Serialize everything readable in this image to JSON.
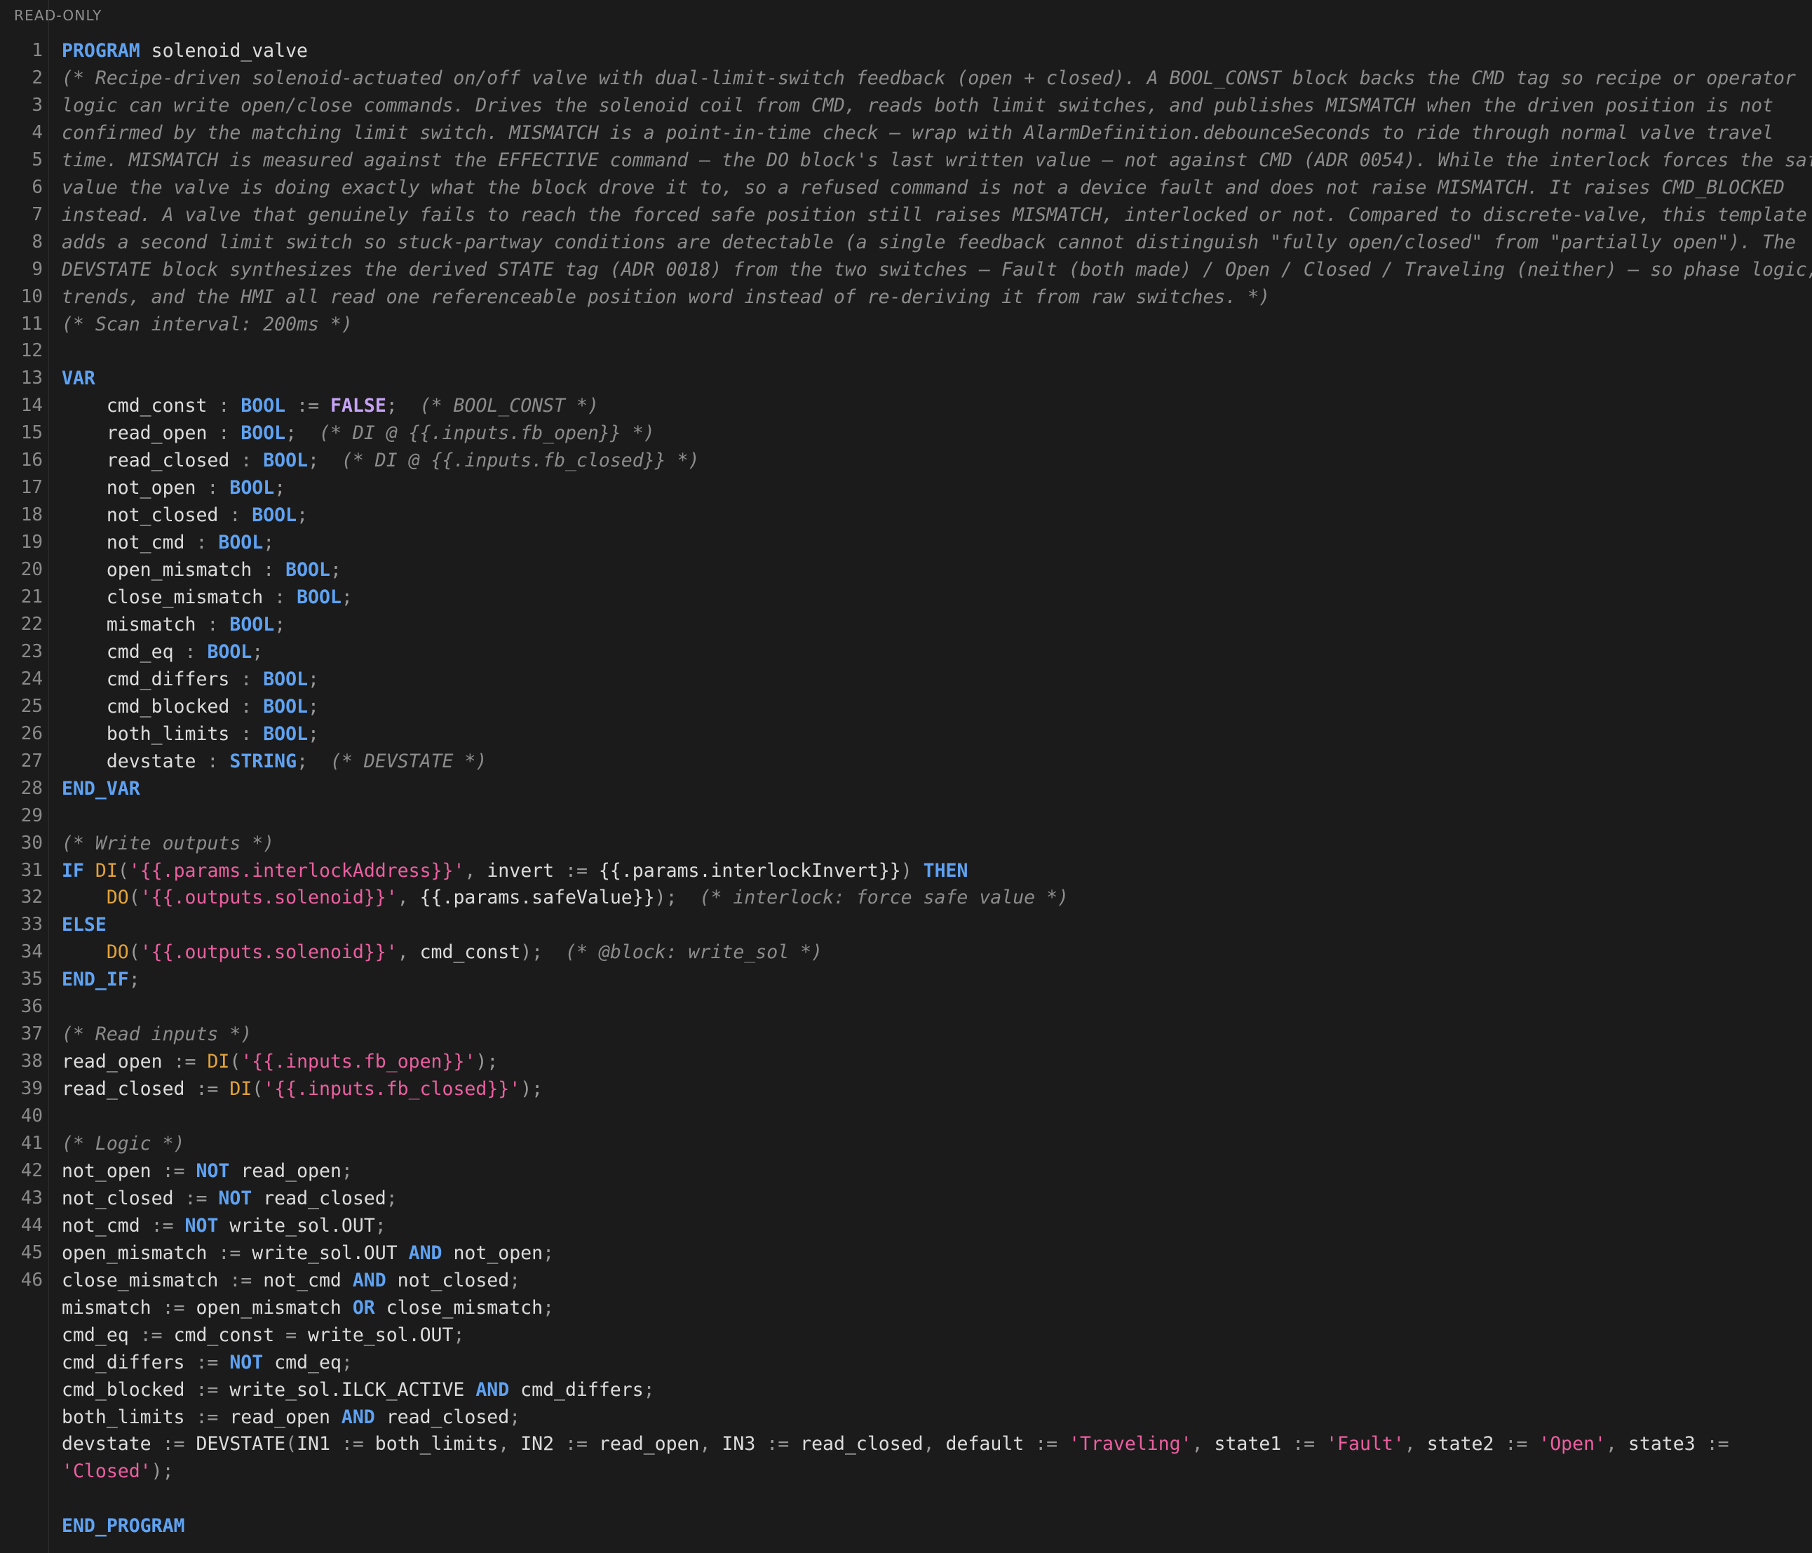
{
  "status": "READ-ONLY",
  "line_numbers": [
    "1",
    "2",
    "3",
    "4",
    "5",
    "6",
    "7",
    "8",
    "9",
    "10",
    "11",
    "12",
    "13",
    "14",
    "15",
    "16",
    "17",
    "18",
    "19",
    "20",
    "21",
    "22",
    "23",
    "24",
    "25",
    "26",
    "27",
    "28",
    "29",
    "30",
    "31",
    "32",
    "33",
    "34",
    "35",
    "36",
    "37",
    "38",
    "39",
    "40",
    "41",
    "42",
    "43",
    "44",
    "45",
    "46"
  ],
  "lines": [
    [
      [
        "kw",
        "PROGRAM"
      ],
      [
        "pl",
        " solenoid_valve"
      ]
    ],
    [
      [
        "cm",
        "(* Recipe-driven solenoid-actuated on/off valve with dual-limit-switch feedback (open + closed). A BOOL_CONST block backs the CMD tag so recipe or operator"
      ]
    ],
    [
      [
        "cm",
        "logic can write open/close commands. Drives the solenoid coil from CMD, reads both limit switches, and publishes MISMATCH when the driven position is not"
      ]
    ],
    [
      [
        "cm",
        "confirmed by the matching limit switch. MISMATCH is a point-in-time check — wrap with AlarmDefinition.debounceSeconds to ride through normal valve travel"
      ]
    ],
    [
      [
        "cm",
        "time. MISMATCH is measured against the EFFECTIVE command — the DO block's last written value — not against CMD (ADR 0054). While the interlock forces the safe"
      ]
    ],
    [
      [
        "cm",
        "value the valve is doing exactly what the block drove it to, so a refused command is not a device fault and does not raise MISMATCH. It raises CMD_BLOCKED"
      ]
    ],
    [
      [
        "cm",
        "instead. A valve that genuinely fails to reach the forced safe position still raises MISMATCH, interlocked or not. Compared to discrete-valve, this template"
      ]
    ],
    [
      [
        "cm",
        "adds a second limit switch so stuck-partway conditions are detectable (a single feedback cannot distinguish \"fully open/closed\" from \"partially open\"). The"
      ]
    ],
    [
      [
        "cm",
        "DEVSTATE block synthesizes the derived STATE tag (ADR 0018) from the two switches — Fault (both made) / Open / Closed / Traveling (neither) — so phase logic,"
      ]
    ],
    [
      [
        "cm",
        "trends, and the HMI all read one referenceable position word instead of re-deriving it from raw switches. *)"
      ]
    ],
    [
      [
        "cm",
        "(* Scan interval: 200ms *)"
      ]
    ],
    [],
    [
      [
        "kw",
        "VAR"
      ]
    ],
    [
      [
        "pl",
        "    cmd_const "
      ],
      [
        "op",
        ":"
      ],
      [
        "pl",
        " "
      ],
      [
        "ty",
        "BOOL"
      ],
      [
        "pl",
        " "
      ],
      [
        "op",
        ":="
      ],
      [
        "pl",
        " "
      ],
      [
        "lit",
        "FALSE"
      ],
      [
        "op",
        ";"
      ],
      [
        "pl",
        "  "
      ],
      [
        "cm",
        "(* BOOL_CONST *)"
      ]
    ],
    [
      [
        "pl",
        "    read_open "
      ],
      [
        "op",
        ":"
      ],
      [
        "pl",
        " "
      ],
      [
        "ty",
        "BOOL"
      ],
      [
        "op",
        ";"
      ],
      [
        "pl",
        "  "
      ],
      [
        "cm",
        "(* DI @ {{.inputs.fb_open}} *)"
      ]
    ],
    [
      [
        "pl",
        "    read_closed "
      ],
      [
        "op",
        ":"
      ],
      [
        "pl",
        " "
      ],
      [
        "ty",
        "BOOL"
      ],
      [
        "op",
        ";"
      ],
      [
        "pl",
        "  "
      ],
      [
        "cm",
        "(* DI @ {{.inputs.fb_closed}} *)"
      ]
    ],
    [
      [
        "pl",
        "    not_open "
      ],
      [
        "op",
        ":"
      ],
      [
        "pl",
        " "
      ],
      [
        "ty",
        "BOOL"
      ],
      [
        "op",
        ";"
      ]
    ],
    [
      [
        "pl",
        "    not_closed "
      ],
      [
        "op",
        ":"
      ],
      [
        "pl",
        " "
      ],
      [
        "ty",
        "BOOL"
      ],
      [
        "op",
        ";"
      ]
    ],
    [
      [
        "pl",
        "    not_cmd "
      ],
      [
        "op",
        ":"
      ],
      [
        "pl",
        " "
      ],
      [
        "ty",
        "BOOL"
      ],
      [
        "op",
        ";"
      ]
    ],
    [
      [
        "pl",
        "    open_mismatch "
      ],
      [
        "op",
        ":"
      ],
      [
        "pl",
        " "
      ],
      [
        "ty",
        "BOOL"
      ],
      [
        "op",
        ";"
      ]
    ],
    [
      [
        "pl",
        "    close_mismatch "
      ],
      [
        "op",
        ":"
      ],
      [
        "pl",
        " "
      ],
      [
        "ty",
        "BOOL"
      ],
      [
        "op",
        ";"
      ]
    ],
    [
      [
        "pl",
        "    mismatch "
      ],
      [
        "op",
        ":"
      ],
      [
        "pl",
        " "
      ],
      [
        "ty",
        "BOOL"
      ],
      [
        "op",
        ";"
      ]
    ],
    [
      [
        "pl",
        "    cmd_eq "
      ],
      [
        "op",
        ":"
      ],
      [
        "pl",
        " "
      ],
      [
        "ty",
        "BOOL"
      ],
      [
        "op",
        ";"
      ]
    ],
    [
      [
        "pl",
        "    cmd_differs "
      ],
      [
        "op",
        ":"
      ],
      [
        "pl",
        " "
      ],
      [
        "ty",
        "BOOL"
      ],
      [
        "op",
        ";"
      ]
    ],
    [
      [
        "pl",
        "    cmd_blocked "
      ],
      [
        "op",
        ":"
      ],
      [
        "pl",
        " "
      ],
      [
        "ty",
        "BOOL"
      ],
      [
        "op",
        ";"
      ]
    ],
    [
      [
        "pl",
        "    both_limits "
      ],
      [
        "op",
        ":"
      ],
      [
        "pl",
        " "
      ],
      [
        "ty",
        "BOOL"
      ],
      [
        "op",
        ";"
      ]
    ],
    [
      [
        "pl",
        "    devstate "
      ],
      [
        "op",
        ":"
      ],
      [
        "pl",
        " "
      ],
      [
        "ty",
        "STRING"
      ],
      [
        "op",
        ";"
      ],
      [
        "pl",
        "  "
      ],
      [
        "cm",
        "(* DEVSTATE *)"
      ]
    ],
    [
      [
        "kw",
        "END_VAR"
      ]
    ],
    [],
    [
      [
        "cm",
        "(* Write outputs *)"
      ]
    ],
    [
      [
        "kw",
        "IF"
      ],
      [
        "pl",
        " "
      ],
      [
        "fn",
        "DI"
      ],
      [
        "op",
        "("
      ],
      [
        "str",
        "'{{.params.interlockAddress}}'"
      ],
      [
        "op",
        ","
      ],
      [
        "pl",
        " invert "
      ],
      [
        "op",
        ":="
      ],
      [
        "pl",
        " {{.params.interlockInvert}}"
      ],
      [
        "op",
        ")"
      ],
      [
        "pl",
        " "
      ],
      [
        "kw",
        "THEN"
      ]
    ],
    [
      [
        "pl",
        "    "
      ],
      [
        "fn",
        "DO"
      ],
      [
        "op",
        "("
      ],
      [
        "str",
        "'{{.outputs.solenoid}}'"
      ],
      [
        "op",
        ","
      ],
      [
        "pl",
        " {{.params.safeValue}}"
      ],
      [
        "op",
        ");"
      ],
      [
        "pl",
        "  "
      ],
      [
        "cm",
        "(* interlock: force safe value *)"
      ]
    ],
    [
      [
        "kw",
        "ELSE"
      ]
    ],
    [
      [
        "pl",
        "    "
      ],
      [
        "fn",
        "DO"
      ],
      [
        "op",
        "("
      ],
      [
        "str",
        "'{{.outputs.solenoid}}'"
      ],
      [
        "op",
        ","
      ],
      [
        "pl",
        " cmd_const"
      ],
      [
        "op",
        ");"
      ],
      [
        "pl",
        "  "
      ],
      [
        "cm",
        "(* @block: write_sol *)"
      ]
    ],
    [
      [
        "kw",
        "END_IF"
      ],
      [
        "op",
        ";"
      ]
    ],
    [],
    [
      [
        "cm",
        "(* Read inputs *)"
      ]
    ],
    [
      [
        "pl",
        "read_open "
      ],
      [
        "op",
        ":="
      ],
      [
        "pl",
        " "
      ],
      [
        "fn",
        "DI"
      ],
      [
        "op",
        "("
      ],
      [
        "str",
        "'{{.inputs.fb_open}}'"
      ],
      [
        "op",
        ");"
      ]
    ],
    [
      [
        "pl",
        "read_closed "
      ],
      [
        "op",
        ":="
      ],
      [
        "pl",
        " "
      ],
      [
        "fn",
        "DI"
      ],
      [
        "op",
        "("
      ],
      [
        "str",
        "'{{.inputs.fb_closed}}'"
      ],
      [
        "op",
        ");"
      ]
    ],
    [],
    [
      [
        "cm",
        "(* Logic *)"
      ]
    ],
    [
      [
        "pl",
        "not_open "
      ],
      [
        "op",
        ":="
      ],
      [
        "pl",
        " "
      ],
      [
        "kw",
        "NOT"
      ],
      [
        "pl",
        " read_open"
      ],
      [
        "op",
        ";"
      ]
    ],
    [
      [
        "pl",
        "not_closed "
      ],
      [
        "op",
        ":="
      ],
      [
        "pl",
        " "
      ],
      [
        "kw",
        "NOT"
      ],
      [
        "pl",
        " read_closed"
      ],
      [
        "op",
        ";"
      ]
    ],
    [
      [
        "pl",
        "not_cmd "
      ],
      [
        "op",
        ":="
      ],
      [
        "pl",
        " "
      ],
      [
        "kw",
        "NOT"
      ],
      [
        "pl",
        " write_sol.OUT"
      ],
      [
        "op",
        ";"
      ]
    ],
    [
      [
        "pl",
        "open_mismatch "
      ],
      [
        "op",
        ":="
      ],
      [
        "pl",
        " write_sol.OUT "
      ],
      [
        "kw",
        "AND"
      ],
      [
        "pl",
        " not_open"
      ],
      [
        "op",
        ";"
      ]
    ],
    [
      [
        "pl",
        "close_mismatch "
      ],
      [
        "op",
        ":="
      ],
      [
        "pl",
        " not_cmd "
      ],
      [
        "kw",
        "AND"
      ],
      [
        "pl",
        " not_closed"
      ],
      [
        "op",
        ";"
      ]
    ],
    [
      [
        "pl",
        "mismatch "
      ],
      [
        "op",
        ":="
      ],
      [
        "pl",
        " open_mismatch "
      ],
      [
        "kw",
        "OR"
      ],
      [
        "pl",
        " close_mismatch"
      ],
      [
        "op",
        ";"
      ]
    ],
    [
      [
        "pl",
        "cmd_eq "
      ],
      [
        "op",
        ":="
      ],
      [
        "pl",
        " cmd_const "
      ],
      [
        "op",
        "="
      ],
      [
        "pl",
        " write_sol.OUT"
      ],
      [
        "op",
        ";"
      ]
    ],
    [
      [
        "pl",
        "cmd_differs "
      ],
      [
        "op",
        ":="
      ],
      [
        "pl",
        " "
      ],
      [
        "kw",
        "NOT"
      ],
      [
        "pl",
        " cmd_eq"
      ],
      [
        "op",
        ";"
      ]
    ],
    [
      [
        "pl",
        "cmd_blocked "
      ],
      [
        "op",
        ":="
      ],
      [
        "pl",
        " write_sol.ILCK_ACTIVE "
      ],
      [
        "kw",
        "AND"
      ],
      [
        "pl",
        " cmd_differs"
      ],
      [
        "op",
        ";"
      ]
    ],
    [
      [
        "pl",
        "both_limits "
      ],
      [
        "op",
        ":="
      ],
      [
        "pl",
        " read_open "
      ],
      [
        "kw",
        "AND"
      ],
      [
        "pl",
        " read_closed"
      ],
      [
        "op",
        ";"
      ]
    ],
    [
      [
        "pl",
        "devstate "
      ],
      [
        "op",
        ":="
      ],
      [
        "pl",
        " DEVSTATE"
      ],
      [
        "op",
        "("
      ],
      [
        "pl",
        "IN1 "
      ],
      [
        "op",
        ":="
      ],
      [
        "pl",
        " both_limits"
      ],
      [
        "op",
        ","
      ],
      [
        "pl",
        " IN2 "
      ],
      [
        "op",
        ":="
      ],
      [
        "pl",
        " read_open"
      ],
      [
        "op",
        ","
      ],
      [
        "pl",
        " IN3 "
      ],
      [
        "op",
        ":="
      ],
      [
        "pl",
        " read_closed"
      ],
      [
        "op",
        ","
      ],
      [
        "pl",
        " default "
      ],
      [
        "op",
        ":="
      ],
      [
        "pl",
        " "
      ],
      [
        "str",
        "'Traveling'"
      ],
      [
        "op",
        ","
      ],
      [
        "pl",
        " state1 "
      ],
      [
        "op",
        ":="
      ],
      [
        "pl",
        " "
      ],
      [
        "str",
        "'Fault'"
      ],
      [
        "op",
        ","
      ],
      [
        "pl",
        " state2 "
      ],
      [
        "op",
        ":="
      ],
      [
        "pl",
        " "
      ],
      [
        "str",
        "'Open'"
      ],
      [
        "op",
        ","
      ],
      [
        "pl",
        " state3 "
      ],
      [
        "op",
        ":="
      ]
    ],
    [
      [
        "str",
        "'Closed'"
      ],
      [
        "op",
        ");"
      ]
    ],
    [],
    [
      [
        "kw",
        "END_PROGRAM"
      ]
    ]
  ]
}
